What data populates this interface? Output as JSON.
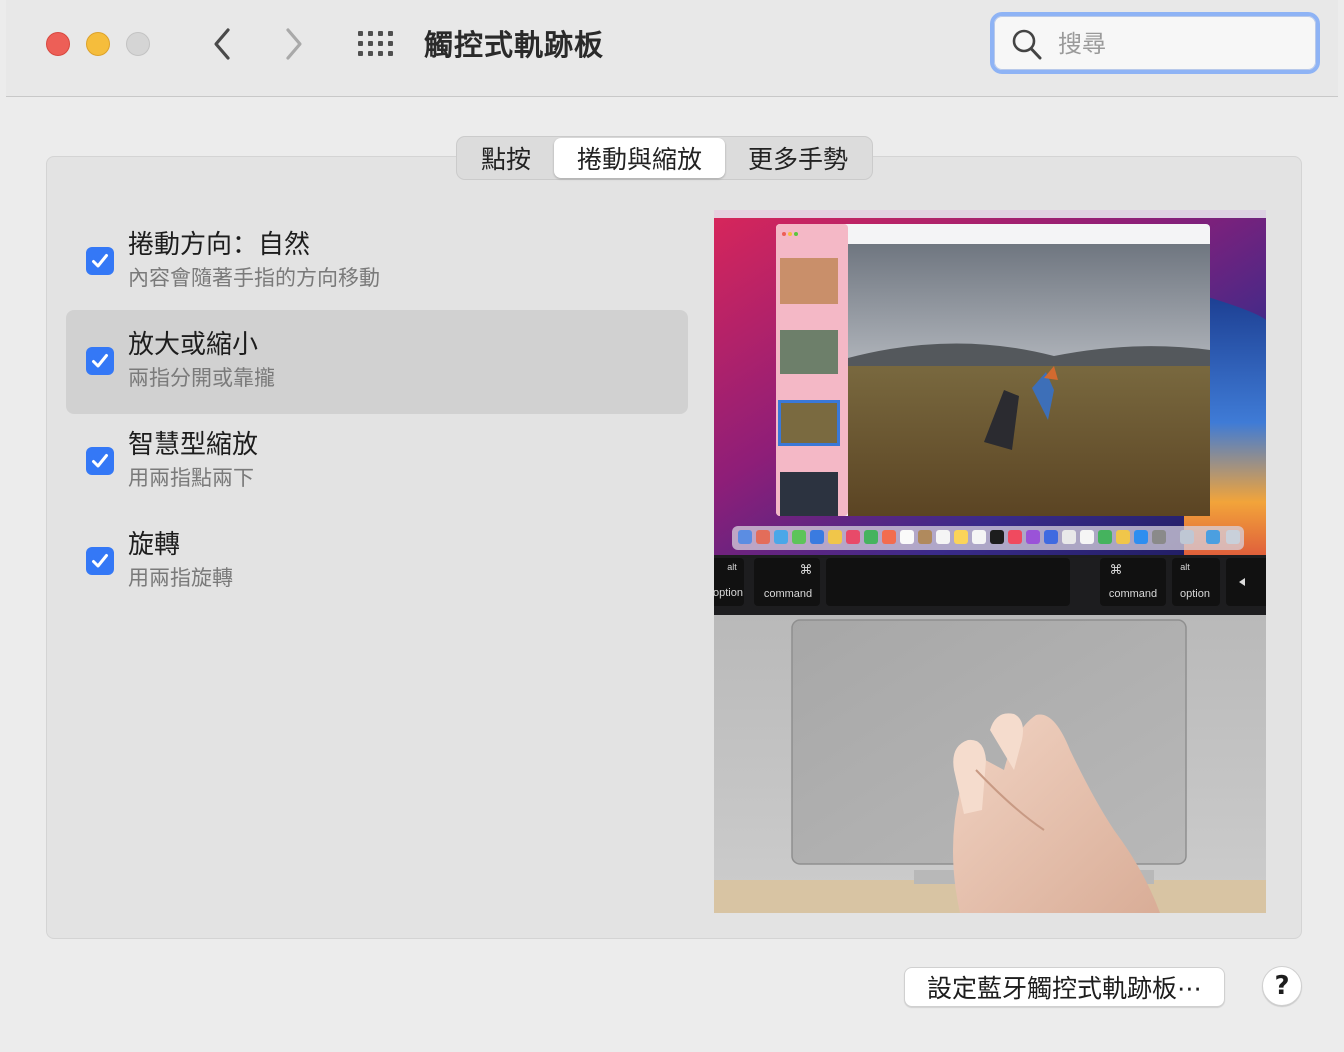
{
  "window": {
    "title": "觸控式軌跡板"
  },
  "search": {
    "placeholder": "搜尋"
  },
  "tabs": [
    {
      "label": "點按",
      "active": false
    },
    {
      "label": "捲動與縮放",
      "active": true
    },
    {
      "label": "更多手勢",
      "active": false
    }
  ],
  "options": [
    {
      "title": "捲動方向：自然",
      "subtitle": "內容會隨著手指的方向移動",
      "checked": true,
      "selected": false
    },
    {
      "title": "放大或縮小",
      "subtitle": "兩指分開或靠攏",
      "checked": true,
      "selected": true
    },
    {
      "title": "智慧型縮放",
      "subtitle": "用兩指點兩下",
      "checked": true,
      "selected": false
    },
    {
      "title": "旋轉",
      "subtitle": "用兩指旋轉",
      "checked": true,
      "selected": false
    }
  ],
  "preview": {
    "keys": {
      "alt": "alt",
      "command_symbol": "⌘",
      "command": "command",
      "option": "option"
    }
  },
  "footer": {
    "bluetooth_button": "設定藍牙觸控式軌跡板⋯",
    "help_label": "?"
  },
  "colors": {
    "accent": "#3478f6",
    "close": "#ed5f57",
    "minimize": "#f5bd3c",
    "zoom": "#d5d5d5"
  }
}
